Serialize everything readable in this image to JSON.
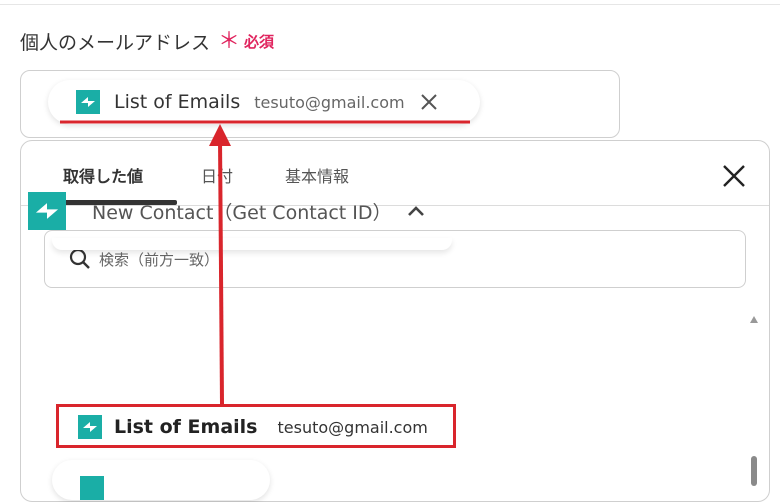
{
  "field": {
    "label": "個人のメールアドレス",
    "required_mark": "＊",
    "required_text": "必須"
  },
  "chip": {
    "label": "List of Emails",
    "value": "tesuto@gmail.com",
    "icon": "app-logo-icon",
    "remove_icon": "close-icon"
  },
  "panel": {
    "tabs": [
      {
        "label": "取得した値",
        "active": true
      },
      {
        "label": "日付",
        "active": false
      },
      {
        "label": "基本情報",
        "active": false
      }
    ],
    "close_icon": "close-icon",
    "search": {
      "placeholder": "検索（前方一致）",
      "icon": "search-icon"
    },
    "group": {
      "title": "New Contact（Get Contact ID）",
      "icon": "app-logo-icon",
      "toggle_icon": "chevron-up-icon"
    },
    "item": {
      "label": "List of Emails",
      "value": "tesuto@gmail.com",
      "icon": "app-logo-icon"
    }
  },
  "colors": {
    "accent_teal": "#1aaea6",
    "required_red": "#e0245e",
    "annotation_red": "#d9252c"
  }
}
